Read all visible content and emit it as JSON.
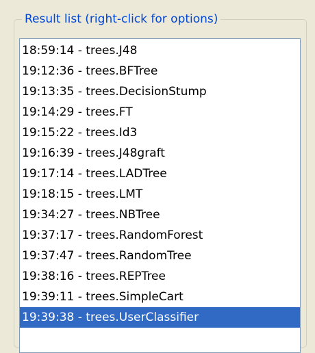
{
  "result_list": {
    "title": "Result list (right-click for options)",
    "selected_index": 13,
    "items": [
      {
        "label": "18:59:14 - trees.J48"
      },
      {
        "label": "19:12:36 - trees.BFTree"
      },
      {
        "label": "19:13:35 - trees.DecisionStump"
      },
      {
        "label": "19:14:29 - trees.FT"
      },
      {
        "label": "19:15:22 - trees.Id3"
      },
      {
        "label": "19:16:39 - trees.J48graft"
      },
      {
        "label": "19:17:14 - trees.LADTree"
      },
      {
        "label": "19:18:15 - trees.LMT"
      },
      {
        "label": "19:34:27 - trees.NBTree"
      },
      {
        "label": "19:37:17 - trees.RandomForest"
      },
      {
        "label": "19:37:47 - trees.RandomTree"
      },
      {
        "label": "19:38:16 - trees.REPTree"
      },
      {
        "label": "19:39:11 - trees.SimpleCart"
      },
      {
        "label": "19:39:38 - trees.UserClassifier"
      }
    ]
  },
  "colors": {
    "title_text": "#0046d5",
    "selection_background": "#316ac5",
    "selection_text": "#ffffff",
    "list_border": "#7f9db9"
  }
}
